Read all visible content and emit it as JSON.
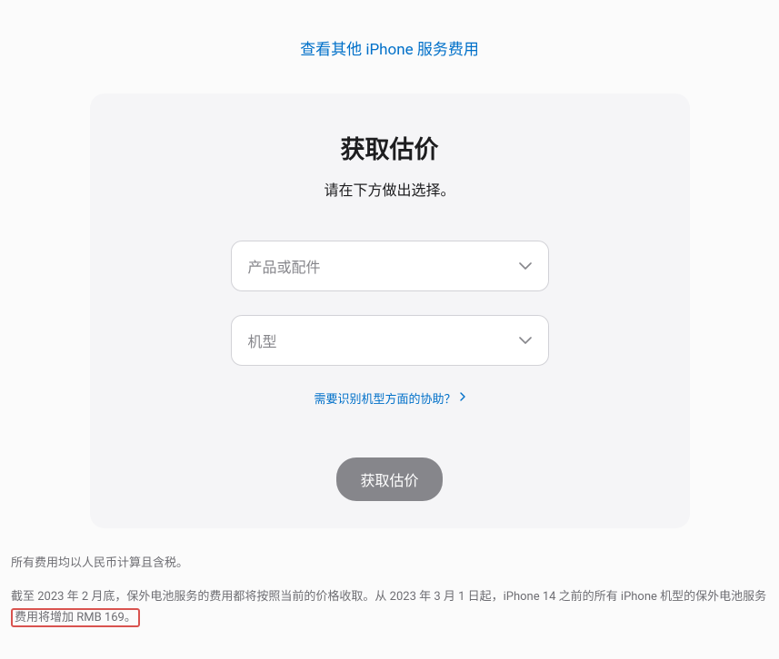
{
  "top_link": {
    "label": "查看其他 iPhone 服务费用"
  },
  "card": {
    "title": "获取估价",
    "subtitle": "请在下方做出选择。",
    "select_product_placeholder": "产品或配件",
    "select_model_placeholder": "机型",
    "help_link_label": "需要识别机型方面的协助？",
    "submit_label": "获取估价"
  },
  "disclaimer": {
    "line1": "所有费用均以人民币计算且含税。",
    "line2_prefix": "截至 2023 年 2 月底，保外电池服务的费用都将按照当前的价格收取。从 2023 年 3 月 1 日起，iPhone 14 之前的所有 iPhone 机型的保外电池服务",
    "line2_highlight": "费用将增加 RMB 169。"
  }
}
